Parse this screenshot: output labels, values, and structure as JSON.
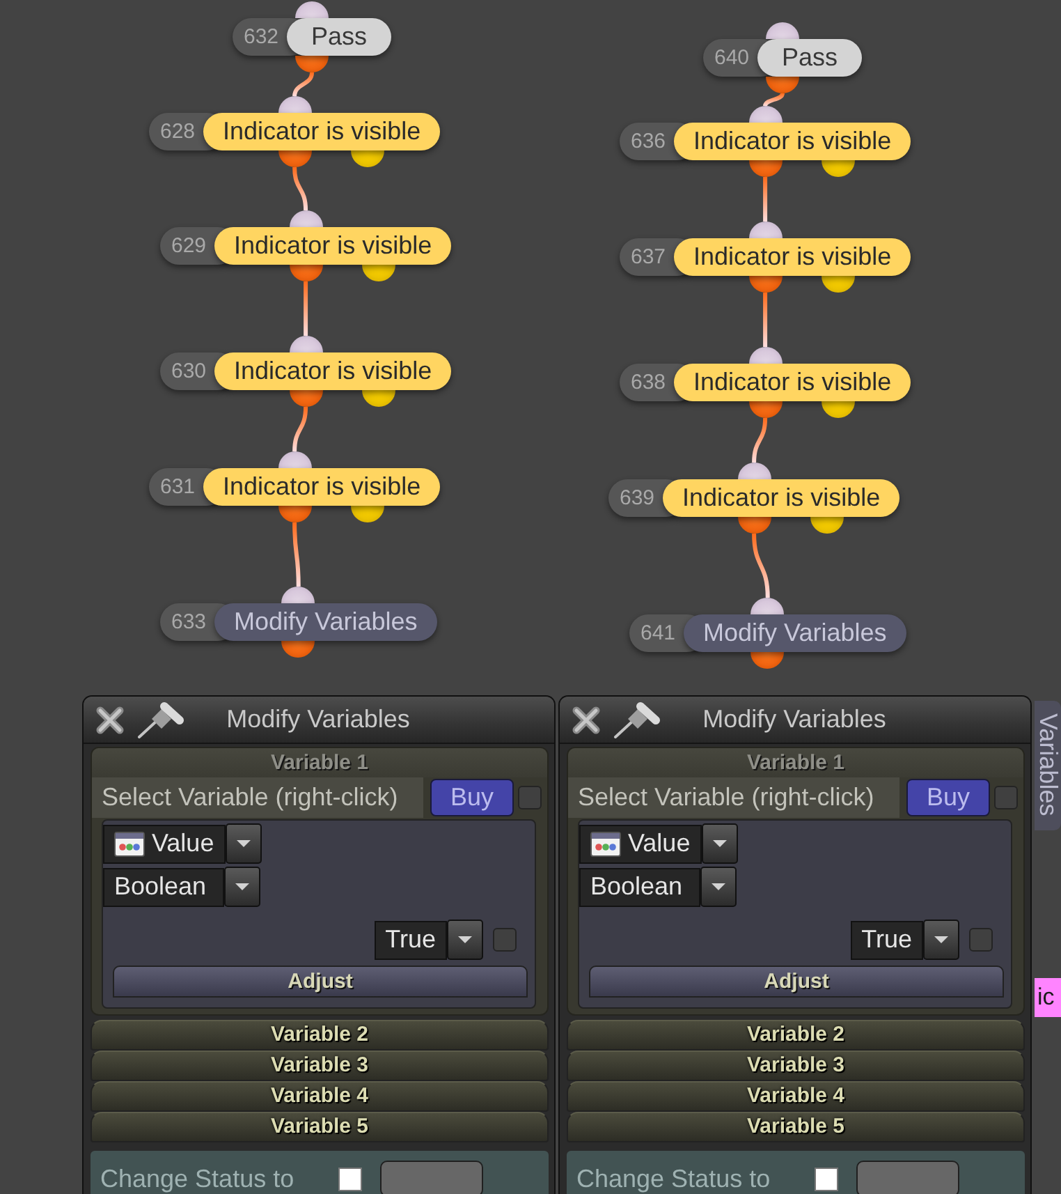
{
  "graph": {
    "chains": [
      {
        "nodes": [
          {
            "number": "632",
            "title": "Pass",
            "kind": "pass"
          },
          {
            "number": "628",
            "title": "Indicator is visible",
            "kind": "condition"
          },
          {
            "number": "629",
            "title": "Indicator is visible",
            "kind": "condition"
          },
          {
            "number": "630",
            "title": "Indicator is visible",
            "kind": "condition"
          },
          {
            "number": "631",
            "title": "Indicator is visible",
            "kind": "condition"
          },
          {
            "number": "633",
            "title": "Modify Variables",
            "kind": "action"
          }
        ]
      },
      {
        "nodes": [
          {
            "number": "640",
            "title": "Pass",
            "kind": "pass"
          },
          {
            "number": "636",
            "title": "Indicator is visible",
            "kind": "condition"
          },
          {
            "number": "637",
            "title": "Indicator is visible",
            "kind": "condition"
          },
          {
            "number": "638",
            "title": "Indicator is visible",
            "kind": "condition"
          },
          {
            "number": "639",
            "title": "Indicator is visible",
            "kind": "condition"
          },
          {
            "number": "641",
            "title": "Modify Variables",
            "kind": "action"
          }
        ]
      }
    ]
  },
  "panels": [
    {
      "title": "Modify Variables",
      "variables": [
        {
          "label": "Variable 1",
          "expanded": true,
          "select_label": "Select Variable (right-click)",
          "buy_button": "Buy",
          "buy_checked": false,
          "source": "Value",
          "type": "Boolean",
          "value": "True",
          "value_checked": false,
          "adjust_button": "Adjust"
        },
        {
          "label": "Variable 2",
          "expanded": false
        },
        {
          "label": "Variable 3",
          "expanded": false
        },
        {
          "label": "Variable 4",
          "expanded": false
        },
        {
          "label": "Variable 5",
          "expanded": false
        }
      ],
      "status": {
        "label": "Change Status to",
        "checked": false
      }
    },
    {
      "title": "Modify Variables",
      "variables": [
        {
          "label": "Variable 1",
          "expanded": true,
          "select_label": "Select Variable (right-click)",
          "buy_button": "Buy",
          "buy_checked": false,
          "source": "Value",
          "type": "Boolean",
          "value": "True",
          "value_checked": false,
          "adjust_button": "Adjust"
        },
        {
          "label": "Variable 2",
          "expanded": false
        },
        {
          "label": "Variable 3",
          "expanded": false
        },
        {
          "label": "Variable 4",
          "expanded": false
        },
        {
          "label": "Variable 5",
          "expanded": false
        }
      ],
      "status": {
        "label": "Change Status to",
        "checked": false
      }
    }
  ],
  "side_tab": {
    "label": "Variables"
  },
  "edge_label": "ic"
}
